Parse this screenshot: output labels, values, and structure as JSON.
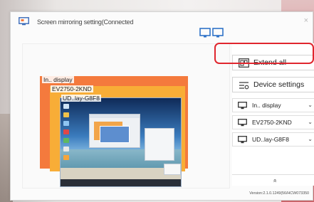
{
  "window": {
    "title": "Screen mirroring setting(Connected",
    "close_glyph": "×",
    "icon": "cast-screen-icon",
    "monitors_icon": "dual-monitor-icon"
  },
  "preview": {
    "displays": [
      {
        "label": "In.. display",
        "color": "#f47a3d"
      },
      {
        "label": "EV2750-2KND",
        "color": "#f8ad37"
      },
      {
        "label": "UD..lay-G8F8",
        "color": "#1c3561"
      }
    ]
  },
  "actions": {
    "extend_all": "Extend all",
    "device_settings": "Device settings"
  },
  "devices": [
    {
      "name": "In.. display",
      "icon": "monitor-icon",
      "chevron": "⌄"
    },
    {
      "name": "EV2750-2KND",
      "icon": "monitor-icon",
      "chevron": "⌄"
    },
    {
      "name": "UD..lay-G8F8",
      "icon": "monitor-icon",
      "chevron": "⌄"
    }
  ],
  "collapse_glyph": "»",
  "version": "Version:2.1.0.1249(56/HCW073350",
  "colors": {
    "highlight": "#e0262e"
  }
}
